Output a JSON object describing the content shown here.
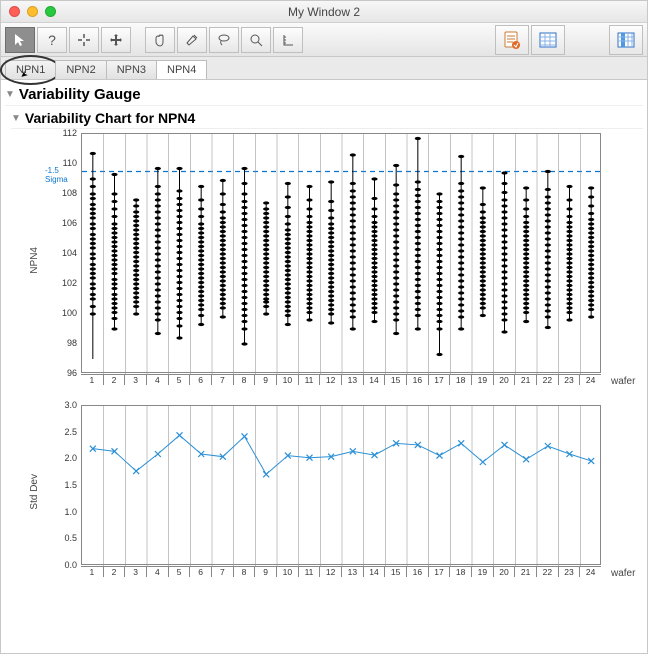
{
  "window": {
    "title": "My Window 2"
  },
  "tabs": [
    {
      "label": "NPN1",
      "active": false,
      "circled": true
    },
    {
      "label": "NPN2",
      "active": false
    },
    {
      "label": "NPN3",
      "active": false
    },
    {
      "label": "NPN4",
      "active": true
    }
  ],
  "section1": {
    "title": "Variability Gauge"
  },
  "section2": {
    "title": "Variability Chart for NPN4"
  },
  "chart_data": [
    {
      "type": "scatter",
      "title": "Variability Chart for NPN4",
      "ylabel": "NPN4",
      "xlabel": "wafer",
      "ylim": [
        96,
        112
      ],
      "yticks": [
        96,
        98,
        100,
        102,
        104,
        106,
        108,
        110,
        112
      ],
      "sigma_label": "-1.5 Sigma",
      "sigma_value": 109.5,
      "categories": [
        "1",
        "2",
        "3",
        "4",
        "5",
        "6",
        "7",
        "8",
        "9",
        "10",
        "11",
        "12",
        "13",
        "14",
        "15",
        "16",
        "17",
        "18",
        "19",
        "20",
        "21",
        "22",
        "23",
        "24"
      ],
      "series": [
        {
          "wafer": "1",
          "min": 97.0,
          "max": 110.7,
          "points": [
            100.0,
            100.5,
            101.0,
            101.3,
            101.7,
            102.0,
            102.4,
            102.7,
            103.0,
            103.3,
            103.7,
            104.0,
            104.4,
            104.7,
            105.0,
            105.3,
            105.7,
            106.0,
            106.4,
            106.7,
            107.0,
            107.3,
            107.7,
            108.0,
            108.5,
            109.0,
            110.7
          ]
        },
        {
          "wafer": "2",
          "min": 99.0,
          "max": 109.3,
          "points": [
            99.0,
            99.7,
            100.1,
            100.4,
            100.7,
            101.0,
            101.3,
            101.7,
            102.0,
            102.3,
            102.7,
            103.0,
            103.3,
            103.6,
            103.9,
            104.2,
            104.5,
            104.8,
            105.1,
            105.4,
            105.7,
            106.0,
            106.5,
            107.0,
            107.5,
            108.0,
            109.3
          ]
        },
        {
          "wafer": "3",
          "min": 100.0,
          "max": 107.6,
          "points": [
            100.0,
            100.5,
            100.8,
            101.1,
            101.4,
            101.7,
            102.0,
            102.3,
            102.6,
            102.9,
            103.2,
            103.5,
            103.8,
            104.1,
            104.4,
            104.7,
            105.0,
            105.3,
            105.6,
            105.9,
            106.2,
            106.5,
            106.8,
            107.2,
            107.6
          ]
        },
        {
          "wafer": "4",
          "min": 98.7,
          "max": 109.7,
          "points": [
            98.7,
            99.6,
            100.0,
            100.4,
            100.8,
            101.2,
            101.6,
            102.0,
            102.4,
            102.8,
            103.2,
            103.6,
            104.0,
            104.4,
            104.8,
            105.2,
            105.6,
            106.0,
            106.4,
            106.8,
            107.2,
            107.6,
            108.0,
            108.5,
            109.7
          ]
        },
        {
          "wafer": "5",
          "min": 98.4,
          "max": 109.7,
          "points": [
            98.4,
            99.2,
            99.7,
            100.1,
            100.5,
            100.9,
            101.3,
            101.7,
            102.1,
            102.5,
            102.9,
            103.3,
            103.7,
            104.1,
            104.5,
            104.9,
            105.3,
            105.7,
            106.1,
            106.5,
            106.9,
            107.3,
            107.7,
            108.2,
            109.7
          ]
        },
        {
          "wafer": "6",
          "min": 99.3,
          "max": 108.5,
          "points": [
            99.3,
            99.9,
            100.3,
            100.6,
            100.9,
            101.2,
            101.5,
            101.8,
            102.1,
            102.4,
            102.7,
            103.0,
            103.3,
            103.6,
            103.9,
            104.2,
            104.5,
            104.8,
            105.1,
            105.4,
            105.7,
            106.0,
            106.5,
            107.0,
            107.6,
            108.5
          ]
        },
        {
          "wafer": "7",
          "min": 99.8,
          "max": 108.9,
          "points": [
            99.8,
            100.4,
            100.7,
            101.0,
            101.3,
            101.6,
            101.9,
            102.2,
            102.5,
            102.8,
            103.1,
            103.4,
            103.7,
            104.0,
            104.3,
            104.6,
            104.9,
            105.2,
            105.5,
            105.8,
            106.1,
            106.4,
            106.8,
            107.3,
            108.0,
            108.9
          ]
        },
        {
          "wafer": "8",
          "min": 98.0,
          "max": 109.7,
          "points": [
            98.0,
            99.0,
            99.5,
            99.9,
            100.3,
            100.7,
            101.1,
            101.5,
            101.9,
            102.3,
            102.7,
            103.1,
            103.5,
            103.9,
            104.3,
            104.7,
            105.1,
            105.5,
            105.9,
            106.3,
            106.7,
            107.1,
            107.5,
            108.0,
            108.7,
            109.7
          ]
        },
        {
          "wafer": "9",
          "min": 100.0,
          "max": 107.4,
          "points": [
            100.0,
            100.5,
            100.8,
            101.0,
            101.3,
            101.6,
            101.9,
            102.2,
            102.5,
            102.8,
            103.1,
            103.4,
            103.7,
            104.0,
            104.3,
            104.6,
            104.9,
            105.2,
            105.5,
            105.8,
            106.1,
            106.4,
            106.7,
            107.0,
            107.4
          ]
        },
        {
          "wafer": "10",
          "min": 99.3,
          "max": 108.7,
          "points": [
            99.3,
            99.9,
            100.2,
            100.5,
            100.8,
            101.1,
            101.4,
            101.7,
            102.0,
            102.3,
            102.6,
            102.9,
            103.2,
            103.5,
            103.8,
            104.1,
            104.4,
            104.7,
            105.0,
            105.3,
            105.6,
            106.0,
            106.5,
            107.1,
            107.8,
            108.7
          ]
        },
        {
          "wafer": "11",
          "min": 99.6,
          "max": 108.5,
          "points": [
            99.6,
            100.1,
            100.4,
            100.7,
            101.0,
            101.3,
            101.6,
            101.9,
            102.2,
            102.5,
            102.8,
            103.1,
            103.4,
            103.7,
            104.0,
            104.3,
            104.6,
            104.9,
            105.2,
            105.5,
            105.8,
            106.1,
            106.5,
            107.0,
            107.6,
            108.5
          ]
        },
        {
          "wafer": "12",
          "min": 99.4,
          "max": 108.8,
          "points": [
            99.4,
            100.0,
            100.3,
            100.6,
            100.9,
            101.2,
            101.5,
            101.8,
            102.1,
            102.4,
            102.7,
            103.0,
            103.3,
            103.6,
            103.9,
            104.2,
            104.5,
            104.8,
            105.1,
            105.4,
            105.7,
            106.0,
            106.4,
            106.9,
            107.5,
            108.8
          ]
        },
        {
          "wafer": "13",
          "min": 99.0,
          "max": 110.6,
          "points": [
            99.0,
            99.8,
            100.2,
            100.6,
            101.0,
            101.4,
            101.8,
            102.2,
            102.6,
            103.0,
            103.4,
            103.8,
            104.2,
            104.6,
            105.0,
            105.4,
            105.8,
            106.2,
            106.6,
            107.0,
            107.4,
            107.8,
            108.2,
            108.7,
            110.6
          ]
        },
        {
          "wafer": "14",
          "min": 99.5,
          "max": 109.0,
          "points": [
            99.5,
            100.1,
            100.4,
            100.7,
            101.0,
            101.3,
            101.6,
            101.9,
            102.2,
            102.5,
            102.8,
            103.1,
            103.4,
            103.7,
            104.0,
            104.3,
            104.6,
            104.9,
            105.2,
            105.5,
            105.8,
            106.1,
            106.5,
            107.0,
            107.7,
            109.0
          ]
        },
        {
          "wafer": "15",
          "min": 98.7,
          "max": 109.9,
          "points": [
            98.7,
            99.6,
            100.0,
            100.4,
            100.8,
            101.2,
            101.6,
            102.0,
            102.4,
            102.8,
            103.2,
            103.6,
            104.0,
            104.4,
            104.8,
            105.2,
            105.6,
            106.0,
            106.4,
            106.8,
            107.2,
            107.6,
            108.0,
            108.6,
            109.9
          ]
        },
        {
          "wafer": "16",
          "min": 99.0,
          "max": 111.7,
          "points": [
            99.0,
            99.9,
            100.3,
            100.7,
            101.1,
            101.5,
            101.9,
            102.3,
            102.7,
            103.1,
            103.5,
            103.9,
            104.3,
            104.7,
            105.1,
            105.5,
            105.9,
            106.3,
            106.7,
            107.1,
            107.5,
            107.9,
            108.3,
            108.8,
            111.7
          ]
        },
        {
          "wafer": "17",
          "min": 97.3,
          "max": 108.0,
          "points": [
            97.3,
            99.0,
            99.5,
            99.9,
            100.3,
            100.7,
            101.1,
            101.5,
            101.9,
            102.3,
            102.7,
            103.1,
            103.5,
            103.9,
            104.3,
            104.7,
            105.1,
            105.5,
            105.9,
            106.3,
            106.7,
            107.1,
            107.5,
            108.0
          ]
        },
        {
          "wafer": "18",
          "min": 99.0,
          "max": 110.5,
          "points": [
            99.0,
            99.8,
            100.2,
            100.6,
            101.0,
            101.4,
            101.8,
            102.2,
            102.6,
            103.0,
            103.4,
            103.8,
            104.2,
            104.6,
            105.0,
            105.4,
            105.8,
            106.2,
            106.6,
            107.0,
            107.4,
            107.8,
            108.2,
            108.7,
            110.5
          ]
        },
        {
          "wafer": "19",
          "min": 99.9,
          "max": 108.4,
          "points": [
            99.9,
            100.4,
            100.7,
            101.0,
            101.3,
            101.6,
            101.9,
            102.2,
            102.5,
            102.8,
            103.1,
            103.4,
            103.7,
            104.0,
            104.3,
            104.6,
            104.9,
            105.2,
            105.5,
            105.8,
            106.1,
            106.4,
            106.8,
            107.3,
            108.4
          ]
        },
        {
          "wafer": "20",
          "min": 98.8,
          "max": 109.4,
          "points": [
            98.8,
            99.6,
            100.0,
            100.4,
            100.8,
            101.2,
            101.6,
            102.0,
            102.4,
            102.8,
            103.2,
            103.6,
            104.0,
            104.4,
            104.8,
            105.2,
            105.6,
            106.0,
            106.4,
            106.8,
            107.2,
            107.6,
            108.1,
            108.7,
            109.4
          ]
        },
        {
          "wafer": "21",
          "min": 99.5,
          "max": 108.4,
          "points": [
            99.5,
            100.1,
            100.4,
            100.7,
            101.0,
            101.3,
            101.6,
            101.9,
            102.2,
            102.5,
            102.8,
            103.1,
            103.4,
            103.7,
            104.0,
            104.3,
            104.6,
            104.9,
            105.2,
            105.5,
            105.8,
            106.1,
            106.5,
            107.0,
            107.6,
            108.4
          ]
        },
        {
          "wafer": "22",
          "min": 99.1,
          "max": 109.5,
          "points": [
            99.1,
            99.8,
            100.2,
            100.6,
            101.0,
            101.4,
            101.8,
            102.2,
            102.6,
            103.0,
            103.4,
            103.8,
            104.2,
            104.6,
            105.0,
            105.4,
            105.8,
            106.2,
            106.6,
            107.0,
            107.4,
            107.8,
            108.3,
            109.5
          ]
        },
        {
          "wafer": "23",
          "min": 99.6,
          "max": 108.5,
          "points": [
            99.6,
            100.1,
            100.4,
            100.7,
            101.0,
            101.3,
            101.6,
            101.9,
            102.2,
            102.5,
            102.8,
            103.1,
            103.4,
            103.7,
            104.0,
            104.3,
            104.6,
            104.9,
            105.2,
            105.5,
            105.8,
            106.1,
            106.5,
            107.0,
            107.6,
            108.5
          ]
        },
        {
          "wafer": "24",
          "min": 99.8,
          "max": 108.4,
          "points": [
            99.8,
            100.3,
            100.6,
            100.9,
            101.2,
            101.5,
            101.8,
            102.1,
            102.4,
            102.7,
            103.0,
            103.3,
            103.6,
            103.9,
            104.2,
            104.5,
            104.8,
            105.1,
            105.4,
            105.7,
            106.0,
            106.3,
            106.7,
            107.2,
            107.8,
            108.4
          ]
        }
      ]
    },
    {
      "type": "line",
      "ylabel": "Std Dev",
      "xlabel": "wafer",
      "ylim": [
        0.0,
        3.0
      ],
      "yticks": [
        0.0,
        0.5,
        1.0,
        1.5,
        2.0,
        2.5,
        3.0
      ],
      "categories": [
        "1",
        "2",
        "3",
        "4",
        "5",
        "6",
        "7",
        "8",
        "9",
        "10",
        "11",
        "12",
        "13",
        "14",
        "15",
        "16",
        "17",
        "18",
        "19",
        "20",
        "21",
        "22",
        "23",
        "24"
      ],
      "values": [
        2.2,
        2.15,
        1.78,
        2.1,
        2.45,
        2.1,
        2.05,
        2.43,
        1.72,
        2.07,
        2.03,
        2.05,
        2.15,
        2.08,
        2.3,
        2.27,
        2.07,
        2.3,
        1.95,
        2.27,
        2.0,
        2.25,
        2.1,
        1.97
      ]
    }
  ],
  "colors": {
    "accent": "#0b76d1",
    "line": "#2b8fd6"
  }
}
